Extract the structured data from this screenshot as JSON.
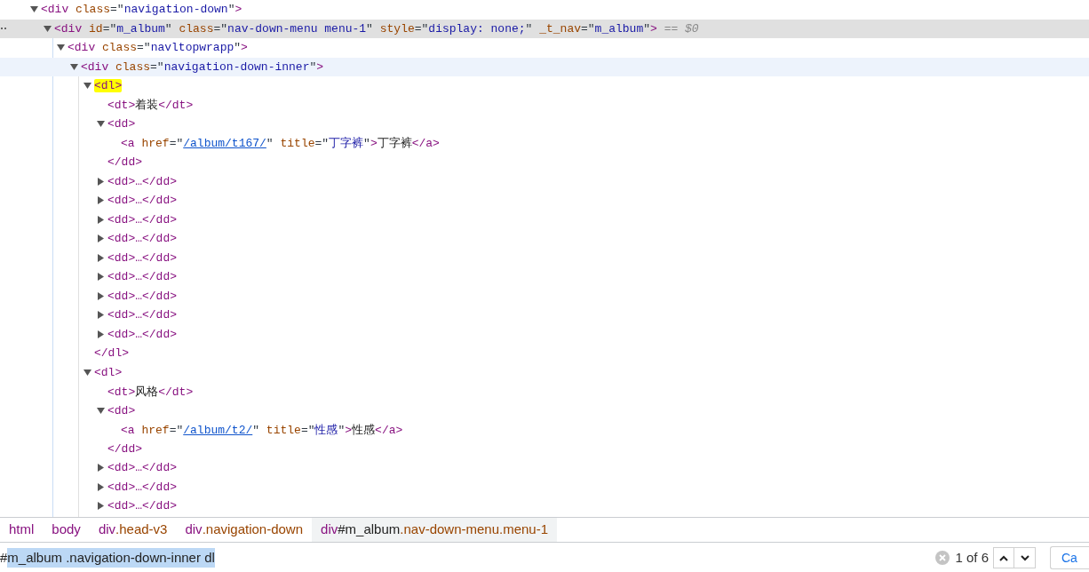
{
  "tree": [
    {
      "expanded": true,
      "tokens": [
        {
          "kind": "tag",
          "s": "<div"
        },
        {
          "kind": "name",
          "s": " class"
        },
        {
          "kind": "punct",
          "s": "=\""
        },
        {
          "kind": "value",
          "s": "navigation-down"
        },
        {
          "kind": "punct",
          "s": "\""
        },
        {
          "kind": "tag",
          "s": ">"
        }
      ],
      "children": [
        {
          "expanded": true,
          "selected": true,
          "tokens": [
            {
              "kind": "tag",
              "s": "<div"
            },
            {
              "kind": "name",
              "s": " id"
            },
            {
              "kind": "punct",
              "s": "=\""
            },
            {
              "kind": "value",
              "s": "m_album"
            },
            {
              "kind": "punct",
              "s": "\""
            },
            {
              "kind": "name",
              "s": " class"
            },
            {
              "kind": "punct",
              "s": "=\""
            },
            {
              "kind": "value",
              "s": "nav-down-menu menu-1"
            },
            {
              "kind": "punct",
              "s": "\""
            },
            {
              "kind": "name",
              "s": " style"
            },
            {
              "kind": "punct",
              "s": "=\""
            },
            {
              "kind": "value",
              "s": "display: none;"
            },
            {
              "kind": "punct",
              "s": "\""
            },
            {
              "kind": "name",
              "s": " _t_nav"
            },
            {
              "kind": "punct",
              "s": "=\""
            },
            {
              "kind": "value",
              "s": "m_album"
            },
            {
              "kind": "punct",
              "s": "\""
            },
            {
              "kind": "tag",
              "s": ">"
            },
            {
              "kind": "ref",
              "s": " == $0"
            }
          ],
          "children": [
            {
              "expanded": true,
              "tokens": [
                {
                  "kind": "tag",
                  "s": "<div"
                },
                {
                  "kind": "name",
                  "s": " class"
                },
                {
                  "kind": "punct",
                  "s": "=\""
                },
                {
                  "kind": "value",
                  "s": "navltopwrapp"
                },
                {
                  "kind": "punct",
                  "s": "\""
                },
                {
                  "kind": "tag",
                  "s": ">"
                }
              ],
              "children": [
                {
                  "expanded": true,
                  "hovered": true,
                  "tokens": [
                    {
                      "kind": "tag",
                      "s": "<div"
                    },
                    {
                      "kind": "name",
                      "s": " class"
                    },
                    {
                      "kind": "punct",
                      "s": "=\""
                    },
                    {
                      "kind": "value",
                      "s": "navigation-down-inner"
                    },
                    {
                      "kind": "punct",
                      "s": "\""
                    },
                    {
                      "kind": "tag",
                      "s": ">"
                    }
                  ],
                  "children": [
                    {
                      "expanded": true,
                      "highlighted": true,
                      "tokens": [
                        {
                          "kind": "tag",
                          "s": "<dl>"
                        }
                      ],
                      "children": [
                        {
                          "tokens": [
                            {
                              "kind": "tag",
                              "s": "<dt>"
                            },
                            {
                              "kind": "text",
                              "s": "着装"
                            },
                            {
                              "kind": "tag",
                              "s": "</dt>"
                            }
                          ]
                        },
                        {
                          "expanded": true,
                          "tokens": [
                            {
                              "kind": "tag",
                              "s": "<dd>"
                            }
                          ],
                          "children": [
                            {
                              "tokens": [
                                {
                                  "kind": "tag",
                                  "s": "<a"
                                },
                                {
                                  "kind": "name",
                                  "s": " href"
                                },
                                {
                                  "kind": "punct",
                                  "s": "=\""
                                },
                                {
                                  "kind": "link",
                                  "s": "/album/t167/"
                                },
                                {
                                  "kind": "punct",
                                  "s": "\""
                                },
                                {
                                  "kind": "name",
                                  "s": " title"
                                },
                                {
                                  "kind": "punct",
                                  "s": "=\""
                                },
                                {
                                  "kind": "value",
                                  "s": "丁字裤"
                                },
                                {
                                  "kind": "punct",
                                  "s": "\""
                                },
                                {
                                  "kind": "tag",
                                  "s": ">"
                                },
                                {
                                  "kind": "text",
                                  "s": "丁字裤"
                                },
                                {
                                  "kind": "tag",
                                  "s": "</a>"
                                }
                              ]
                            }
                          ],
                          "closing": [
                            {
                              "kind": "tag",
                              "s": "</dd>"
                            }
                          ]
                        },
                        {
                          "expanded": false,
                          "tokens": [
                            {
                              "kind": "tag",
                              "s": "<dd>…</dd>"
                            }
                          ]
                        },
                        {
                          "expanded": false,
                          "tokens": [
                            {
                              "kind": "tag",
                              "s": "<dd>…</dd>"
                            }
                          ]
                        },
                        {
                          "expanded": false,
                          "tokens": [
                            {
                              "kind": "tag",
                              "s": "<dd>…</dd>"
                            }
                          ]
                        },
                        {
                          "expanded": false,
                          "tokens": [
                            {
                              "kind": "tag",
                              "s": "<dd>…</dd>"
                            }
                          ]
                        },
                        {
                          "expanded": false,
                          "tokens": [
                            {
                              "kind": "tag",
                              "s": "<dd>…</dd>"
                            }
                          ]
                        },
                        {
                          "expanded": false,
                          "tokens": [
                            {
                              "kind": "tag",
                              "s": "<dd>…</dd>"
                            }
                          ]
                        },
                        {
                          "expanded": false,
                          "tokens": [
                            {
                              "kind": "tag",
                              "s": "<dd>…</dd>"
                            }
                          ]
                        },
                        {
                          "expanded": false,
                          "tokens": [
                            {
                              "kind": "tag",
                              "s": "<dd>…</dd>"
                            }
                          ]
                        },
                        {
                          "expanded": false,
                          "tokens": [
                            {
                              "kind": "tag",
                              "s": "<dd>…</dd>"
                            }
                          ]
                        }
                      ],
                      "closing": [
                        {
                          "kind": "tag",
                          "s": "</dl>"
                        }
                      ]
                    },
                    {
                      "expanded": true,
                      "tokens": [
                        {
                          "kind": "tag",
                          "s": "<dl>"
                        }
                      ],
                      "children": [
                        {
                          "tokens": [
                            {
                              "kind": "tag",
                              "s": "<dt>"
                            },
                            {
                              "kind": "text",
                              "s": "风格"
                            },
                            {
                              "kind": "tag",
                              "s": "</dt>"
                            }
                          ]
                        },
                        {
                          "expanded": true,
                          "tokens": [
                            {
                              "kind": "tag",
                              "s": "<dd>"
                            }
                          ],
                          "children": [
                            {
                              "tokens": [
                                {
                                  "kind": "tag",
                                  "s": "<a"
                                },
                                {
                                  "kind": "name",
                                  "s": " href"
                                },
                                {
                                  "kind": "punct",
                                  "s": "=\""
                                },
                                {
                                  "kind": "link",
                                  "s": "/album/t2/"
                                },
                                {
                                  "kind": "punct",
                                  "s": "\""
                                },
                                {
                                  "kind": "name",
                                  "s": " title"
                                },
                                {
                                  "kind": "punct",
                                  "s": "=\""
                                },
                                {
                                  "kind": "value",
                                  "s": "性感"
                                },
                                {
                                  "kind": "punct",
                                  "s": "\""
                                },
                                {
                                  "kind": "tag",
                                  "s": ">"
                                },
                                {
                                  "kind": "text",
                                  "s": "性感"
                                },
                                {
                                  "kind": "tag",
                                  "s": "</a>"
                                }
                              ]
                            }
                          ],
                          "closing": [
                            {
                              "kind": "tag",
                              "s": "</dd>"
                            }
                          ]
                        },
                        {
                          "expanded": false,
                          "tokens": [
                            {
                              "kind": "tag",
                              "s": "<dd>…</dd>"
                            }
                          ]
                        },
                        {
                          "expanded": false,
                          "tokens": [
                            {
                              "kind": "tag",
                              "s": "<dd>…</dd>"
                            }
                          ]
                        },
                        {
                          "expanded": false,
                          "tokens": [
                            {
                              "kind": "tag",
                              "s": "<dd>…</dd>"
                            }
                          ]
                        }
                      ]
                    }
                  ]
                }
              ]
            }
          ]
        }
      ]
    }
  ],
  "breadcrumbs": [
    {
      "selected": false,
      "parts": [
        {
          "kind": "tag",
          "s": "html"
        }
      ]
    },
    {
      "selected": false,
      "parts": [
        {
          "kind": "tag",
          "s": "body"
        }
      ]
    },
    {
      "selected": false,
      "parts": [
        {
          "kind": "tag",
          "s": "div"
        },
        {
          "kind": "cls",
          "s": ".head-v3"
        }
      ]
    },
    {
      "selected": false,
      "parts": [
        {
          "kind": "tag",
          "s": "div"
        },
        {
          "kind": "cls",
          "s": ".navigation-down"
        }
      ]
    },
    {
      "selected": true,
      "parts": [
        {
          "kind": "tag",
          "s": "div"
        },
        {
          "kind": "id",
          "s": "#m_album"
        },
        {
          "kind": "cls",
          "s": ".nav-down-menu.menu-1"
        }
      ]
    }
  ],
  "search": {
    "prefix": "#",
    "value": "m_album .navigation-down-inner dl",
    "matches": "1 of 6",
    "cancel": "Ca"
  }
}
